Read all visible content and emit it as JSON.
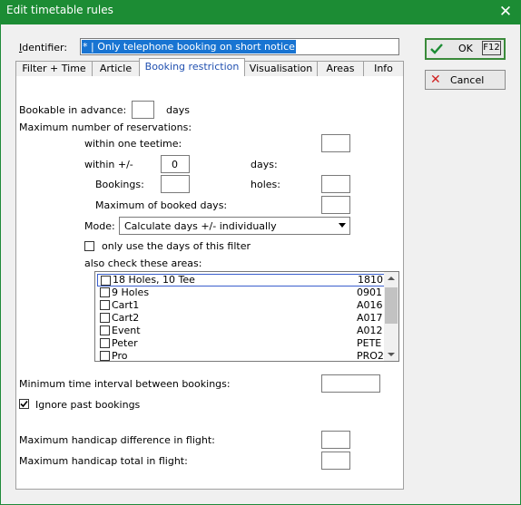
{
  "window": {
    "title": "Edit timetable rules",
    "close_symbol": "✕"
  },
  "identifier": {
    "label": "Identifier:",
    "value": "* | Only telephone booking on short notice"
  },
  "tabs": [
    {
      "label": "Filter + Time",
      "active": false
    },
    {
      "label": "Article",
      "active": false
    },
    {
      "label": "Booking restriction",
      "active": true
    },
    {
      "label": "Visualisation",
      "active": false
    },
    {
      "label": "Areas",
      "active": false
    },
    {
      "label": "Info",
      "active": false
    }
  ],
  "booking": {
    "bookable_label": "Bookable in advance:",
    "bookable_value": "",
    "days_unit": "days",
    "max_reservations_label": "Maximum number of reservations:",
    "within_teetime_label": "within one teetime:",
    "within_teetime_value": "",
    "within_pm_label": "within +/-",
    "within_pm_value": "0",
    "within_pm_unit": "days:",
    "bookings_label": "Bookings:",
    "bookings_value": "",
    "holes_label": "holes:",
    "holes_value": "",
    "max_booked_days_label": "Maximum of booked days:",
    "max_booked_days_value": "",
    "mode_label": "Mode:",
    "mode_value": "Calculate days +/- individually",
    "only_days_label": "only use the days of this filter",
    "only_days_checked": false,
    "also_check_label": "also check these areas:",
    "areas": [
      {
        "name": "18 Holes, 10 Tee",
        "code": "1810",
        "checked": false
      },
      {
        "name": "9 Holes",
        "code": "0901",
        "checked": false
      },
      {
        "name": "Cart1",
        "code": "A016",
        "checked": false
      },
      {
        "name": "Cart2",
        "code": "A017",
        "checked": false
      },
      {
        "name": "Event",
        "code": "A012",
        "checked": false
      },
      {
        "name": "Peter",
        "code": "PETE",
        "checked": false
      },
      {
        "name": "Pro",
        "code": "PRO2",
        "checked": false
      }
    ],
    "min_interval_label": "Minimum time interval between bookings:",
    "min_interval_value": "",
    "ignore_past_label": "Ignore past bookings",
    "ignore_past_checked": true,
    "max_hcp_diff_label": "Maximum handicap difference in flight:",
    "max_hcp_diff_value": "",
    "max_hcp_total_label": "Maximum handicap total in flight:",
    "max_hcp_total_value": ""
  },
  "buttons": {
    "ok_label": "OK",
    "ok_shortcut": "F12",
    "cancel_label": "Cancel"
  },
  "colors": {
    "titlebar": "#1c8c34",
    "ok_icon": "#1c8c34",
    "cancel_icon": "#d02020",
    "active_tab_text": "#2050b0"
  }
}
